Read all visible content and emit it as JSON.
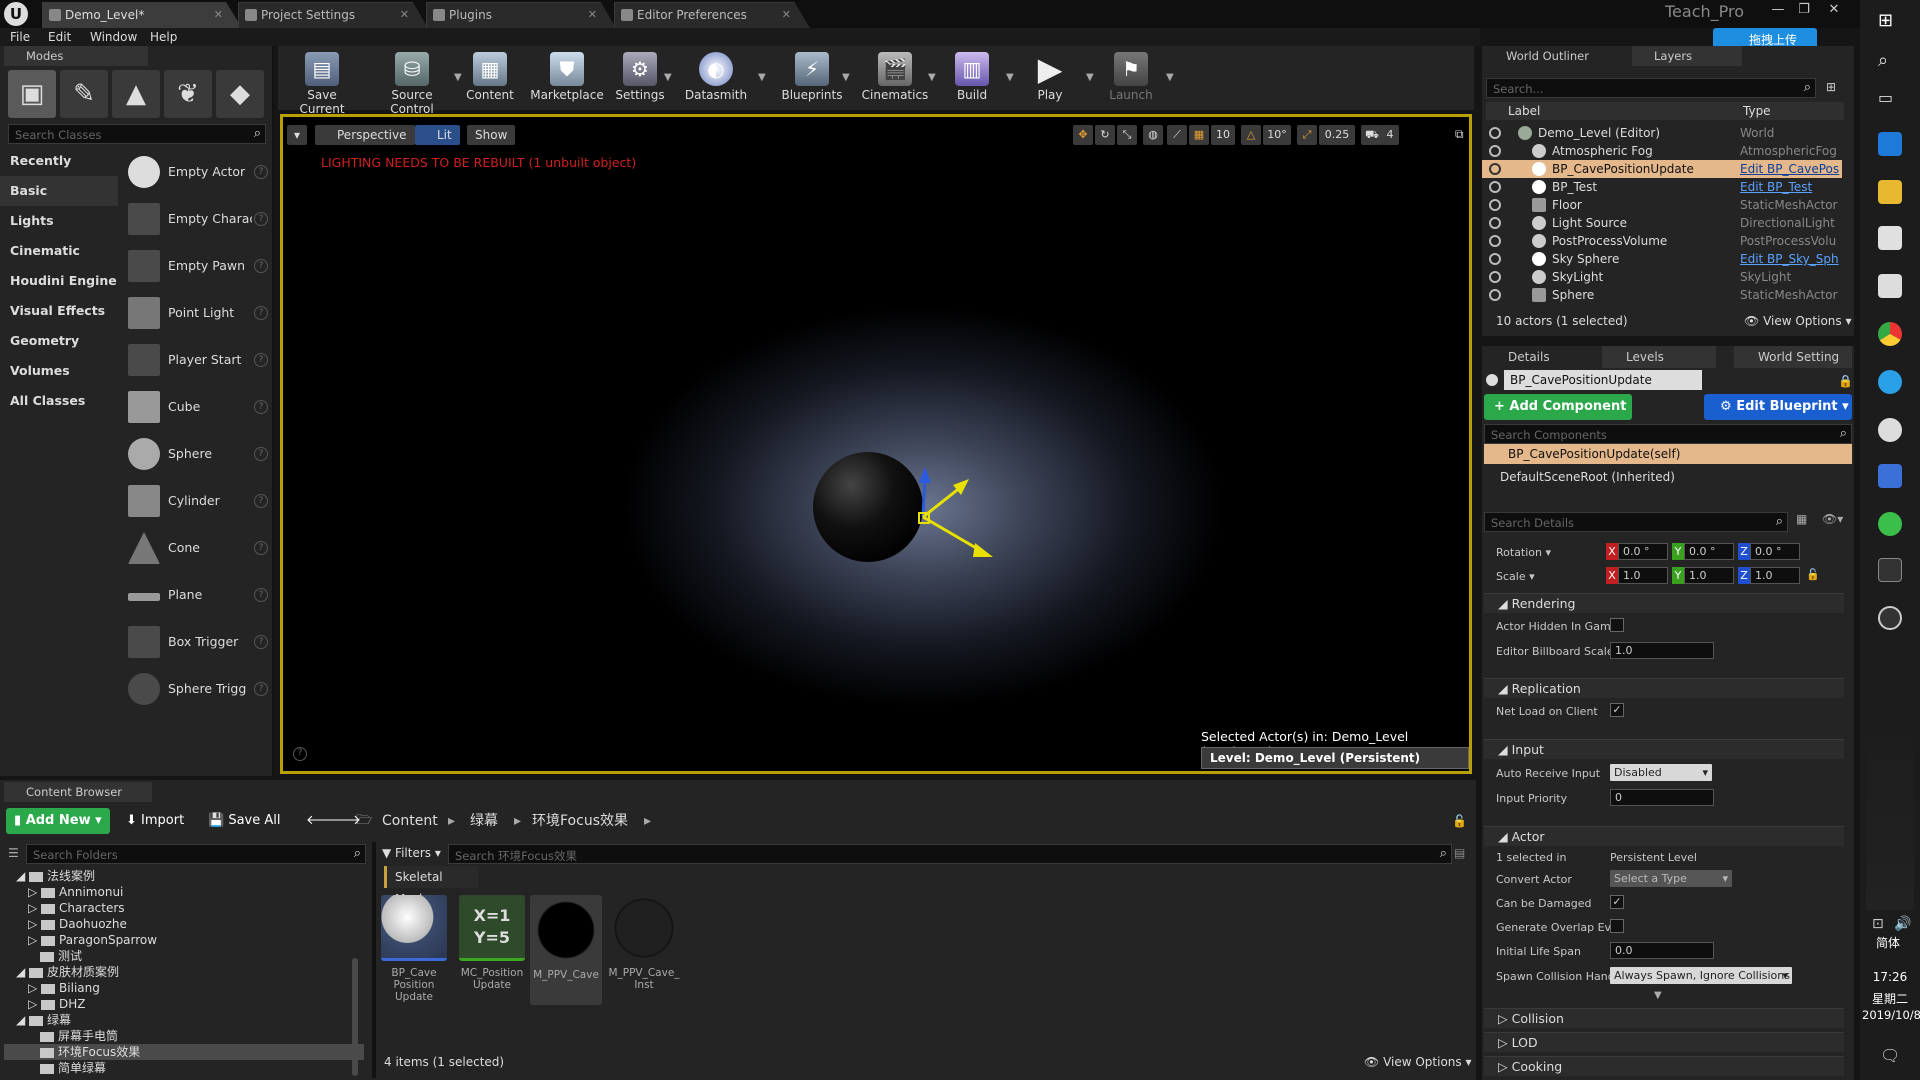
{
  "titlebar": {
    "tabs": [
      {
        "label": "Demo_Level*",
        "active": true
      },
      {
        "label": "Project Settings",
        "active": false
      },
      {
        "label": "Plugins",
        "active": false
      },
      {
        "label": "Editor Preferences",
        "active": false
      }
    ],
    "user": "Teach_Pro",
    "cloud_button": "拖拽上传"
  },
  "menu": [
    "File",
    "Edit",
    "Window",
    "Help"
  ],
  "modes": {
    "tab": "Modes",
    "search_placeholder": "Search Classes",
    "categories": [
      "Recently Placed",
      "Basic",
      "Lights",
      "Cinematic",
      "Houdini Engine",
      "Visual Effects",
      "Geometry",
      "Volumes",
      "All Classes"
    ],
    "selected_category": "Basic",
    "items": [
      "Empty Actor",
      "Empty Charac",
      "Empty Pawn",
      "Point Light",
      "Player Start",
      "Cube",
      "Sphere",
      "Cylinder",
      "Cone",
      "Plane",
      "Box Trigger",
      "Sphere Trigg"
    ]
  },
  "toolbar": {
    "buttons": [
      "Save Current",
      "Source Control",
      "Content",
      "Marketplace",
      "Settings",
      "Datasmith",
      "Blueprints",
      "Cinematics",
      "Build",
      "Play",
      "Launch"
    ]
  },
  "viewport": {
    "perspective": "Perspective",
    "lit": "Lit",
    "show": "Show",
    "warning": "LIGHTING NEEDS TO BE REBUILT (1 unbuilt object)",
    "grid_snap": "10",
    "rot_snap": "10°",
    "scale_snap": "0.25",
    "cam_speed": "4",
    "selected_info": "Selected Actor(s) in:  Demo_Level (Persistent)",
    "level": "Level:  Demo_Level (Persistent)"
  },
  "outliner": {
    "tabs": [
      "World Outliner",
      "Layers"
    ],
    "search_placeholder": "Search...",
    "col_label": "Label",
    "col_type": "Type",
    "rows": [
      {
        "label": "Demo_Level (Editor)",
        "type": "World",
        "link": false
      },
      {
        "label": "Atmospheric Fog",
        "type": "AtmosphericFog",
        "link": false
      },
      {
        "label": "BP_CavePositionUpdate",
        "type": "Edit BP_CavePos",
        "link": true
      },
      {
        "label": "BP_Test",
        "type": "Edit BP_Test",
        "link": true
      },
      {
        "label": "Floor",
        "type": "StaticMeshActor",
        "link": false
      },
      {
        "label": "Light Source",
        "type": "DirectionalLight",
        "link": false
      },
      {
        "label": "PostProcessVolume",
        "type": "PostProcessVolu",
        "link": false
      },
      {
        "label": "Sky Sphere",
        "type": "Edit BP_Sky_Sph",
        "link": true
      },
      {
        "label": "SkyLight",
        "type": "SkyLight",
        "link": false
      },
      {
        "label": "Sphere",
        "type": "StaticMeshActor",
        "link": false
      }
    ],
    "status": "10 actors (1 selected)",
    "view_options": "View Options"
  },
  "details": {
    "tabs": [
      "Details",
      "Levels",
      "World Setting"
    ],
    "name": "BP_CavePositionUpdate",
    "add_component": "+ Add Component",
    "edit_blueprint": "Edit Blueprint",
    "search_components": "Search Components",
    "component_self": "BP_CavePositionUpdate(self)",
    "component_root": "DefaultSceneRoot (Inherited)",
    "search_details": "Search Details",
    "rotation_label": "Rotation",
    "rotation": [
      "0.0 °",
      "0.0 °",
      "0.0 °"
    ],
    "scale_label": "Scale",
    "scale": [
      "1.0",
      "1.0",
      "1.0"
    ],
    "sections": {
      "rendering": "Rendering",
      "replication": "Replication",
      "input": "Input",
      "actor": "Actor",
      "collision": "Collision",
      "lod": "LOD",
      "cooking": "Cooking"
    },
    "props": {
      "actor_hidden": "Actor Hidden In Game",
      "billboard_scale": "Editor Billboard Scale",
      "billboard_value": "1.0",
      "net_load": "Net Load on Client",
      "auto_receive": "Auto Receive Input",
      "auto_receive_value": "Disabled",
      "input_priority": "Input Priority",
      "input_priority_value": "0",
      "selected_in": "1 selected in",
      "selected_in_value": "Persistent Level",
      "convert_actor": "Convert Actor",
      "convert_actor_value": "Select a Type",
      "can_be_damaged": "Can be Damaged",
      "gen_overlap": "Generate Overlap Eve",
      "life_span": "Initial Life Span",
      "life_span_value": "0.0",
      "spawn_collision": "Spawn Collision Hand",
      "spawn_collision_value": "Always Spawn, Ignore Collisions"
    }
  },
  "content_browser": {
    "tab": "Content Browser",
    "add_new": "Add New",
    "import": "Import",
    "save_all": "Save All",
    "breadcrumbs": [
      "Content",
      "绿幕",
      "环境Focus效果"
    ],
    "search_folders": "Search Folders",
    "filters": "Filters",
    "search_assets": "Search 环境Focus效果",
    "filter_chip": "Skeletal Mesh",
    "folders": [
      {
        "label": "法线案例",
        "indent": 1
      },
      {
        "label": "Annimonui",
        "indent": 2
      },
      {
        "label": "Characters",
        "indent": 2
      },
      {
        "label": "Daohuozhe",
        "indent": 2
      },
      {
        "label": "ParagonSparrow",
        "indent": 2
      },
      {
        "label": "测试",
        "indent": 2
      },
      {
        "label": "皮肤材质案例",
        "indent": 1
      },
      {
        "label": "Biliang",
        "indent": 2
      },
      {
        "label": "DHZ",
        "indent": 2
      },
      {
        "label": "绿幕",
        "indent": 1
      },
      {
        "label": "屏幕手电筒",
        "indent": 2
      },
      {
        "label": "环境Focus效果",
        "indent": 2,
        "selected": true
      },
      {
        "label": "简单绿幕",
        "indent": 2
      }
    ],
    "assets": [
      {
        "label": "BP_Cave Position Update",
        "thumb": "sphere-white"
      },
      {
        "label": "MC_Position Update",
        "thumb": "func"
      },
      {
        "label": "M_PPV_Cave",
        "thumb": "black"
      },
      {
        "label": "M_PPV_Cave_ Inst",
        "thumb": "dark"
      }
    ],
    "func_text": "X=1\nY=5",
    "status": "4 items (1 selected)",
    "view_options": "View Options"
  },
  "taskbar": {
    "time": "17:26",
    "weekday": "星期二",
    "date": "2019/10/8",
    "ime": "简体"
  }
}
